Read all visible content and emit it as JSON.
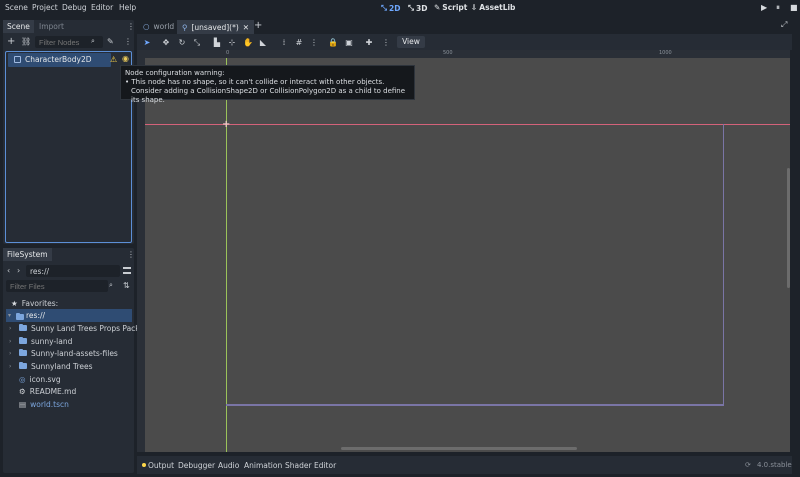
{
  "menu": {
    "items": [
      "Scene",
      "Project",
      "Debug",
      "Editor",
      "Help"
    ]
  },
  "modes": {
    "mode_2d": "2D",
    "mode_3d": "3D",
    "script": "Script",
    "assetlib": "AssetLib"
  },
  "scene_dock": {
    "tab_scene": "Scene",
    "tab_import": "Import",
    "filter_placeholder": "Filter Nodes",
    "node_name": "CharacterBody2D"
  },
  "tooltip": {
    "title": "Node configuration warning:",
    "line1": "• This node has no shape, so it can't collide or interact with other objects.",
    "line2": "Consider adding a CollisionShape2D or CollisionPolygon2D as a child to define its shape."
  },
  "filesystem": {
    "tab": "FileSystem",
    "path": "res://",
    "filter_placeholder": "Filter Files",
    "favorites": "Favorites:",
    "root": "res://",
    "items": [
      {
        "name": "Sunny Land Trees Props Pack",
        "type": "folder"
      },
      {
        "name": "sunny-land",
        "type": "folder"
      },
      {
        "name": "Sunny-land-assets-files",
        "type": "folder"
      },
      {
        "name": "Sunnyland Trees",
        "type": "folder"
      },
      {
        "name": "icon.svg",
        "type": "image"
      },
      {
        "name": "README.md",
        "type": "text"
      },
      {
        "name": "world.tscn",
        "type": "scene"
      }
    ]
  },
  "editor_tabs": {
    "tab1": "world",
    "tab2": "[unsaved](*)"
  },
  "toolbar": {
    "view_label": "View"
  },
  "rulers": {
    "top": [
      "0",
      "500",
      "1000"
    ]
  },
  "bottom_tabs": {
    "output": "Output",
    "debugger": "Debugger",
    "audio": "Audio",
    "animation": "Animation",
    "shader_editor": "Shader Editor",
    "version": "4.0.stable"
  },
  "colors": {
    "accent": "#6fa8ff",
    "warning": "#ffd84a",
    "selected": "#2f4c73",
    "viewport": "#4b4b4b",
    "axis_x": "#d4627a",
    "axis_y": "#9bc35a"
  }
}
